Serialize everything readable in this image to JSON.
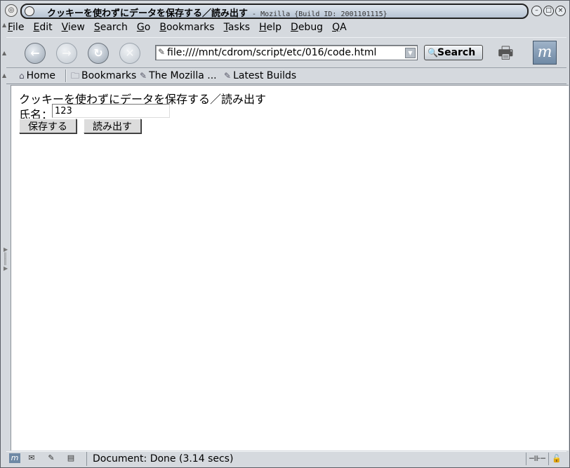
{
  "window": {
    "title": "クッキーを使わずにデータを保存する／読み出す",
    "subtitle": " - Mozilla {Build ID: 2001101115}"
  },
  "menu": [
    "File",
    "Edit",
    "View",
    "Search",
    "Go",
    "Bookmarks",
    "Tasks",
    "Help",
    "Debug",
    "QA"
  ],
  "nav": {
    "url": "file:////mnt/cdrom/script/etc/016/code.html",
    "search_label": "Search"
  },
  "personal_toolbar": {
    "home": "Home",
    "bookmarks": "Bookmarks",
    "mozilla": "The Mozilla ...",
    "latest_builds": "Latest Builds"
  },
  "content": {
    "heading": "クッキーを使わずにデータを保存する／読み出す",
    "name_label": "氏名：",
    "name_value": "123",
    "save_button": "保存する",
    "load_button": "読み出す"
  },
  "status": {
    "message": "Document: Done (3.14 secs)"
  },
  "colors": {
    "chrome": "#d5d9de",
    "content_bg": "#ffffff"
  }
}
